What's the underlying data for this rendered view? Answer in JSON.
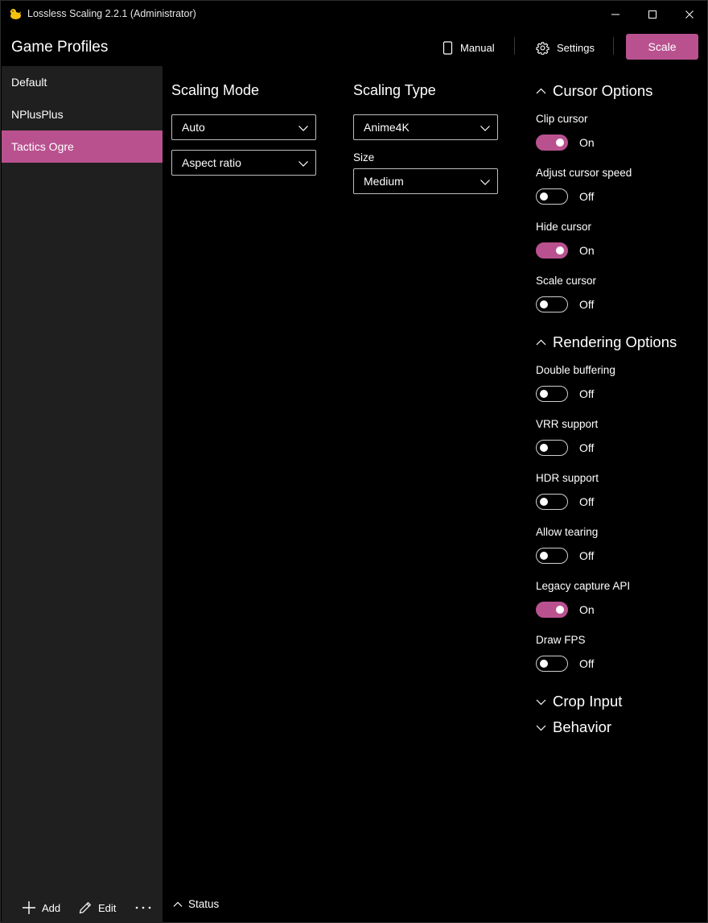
{
  "window": {
    "title": "Lossless Scaling 2.2.1 (Administrator)"
  },
  "header": {
    "title": "Game Profiles",
    "manual_label": "Manual",
    "settings_label": "Settings",
    "scale_label": "Scale"
  },
  "sidebar": {
    "items": [
      {
        "label": "Default",
        "selected": false
      },
      {
        "label": "NPlusPlus",
        "selected": false
      },
      {
        "label": "Tactics Ogre",
        "selected": true
      }
    ],
    "add_label": "Add",
    "edit_label": "Edit"
  },
  "scaling_mode": {
    "heading": "Scaling Mode",
    "mode_value": "Auto",
    "fit_value": "Aspect ratio"
  },
  "scaling_type": {
    "heading": "Scaling Type",
    "type_value": "Anime4K",
    "size_label": "Size",
    "size_value": "Medium"
  },
  "cursor_options": {
    "heading": "Cursor Options",
    "expanded": true,
    "items": [
      {
        "label": "Clip cursor",
        "state": "On"
      },
      {
        "label": "Adjust cursor speed",
        "state": "Off"
      },
      {
        "label": "Hide cursor",
        "state": "On"
      },
      {
        "label": "Scale cursor",
        "state": "Off"
      }
    ]
  },
  "rendering_options": {
    "heading": "Rendering Options",
    "expanded": true,
    "items": [
      {
        "label": "Double buffering",
        "state": "Off"
      },
      {
        "label": "VRR support",
        "state": "Off"
      },
      {
        "label": "HDR support",
        "state": "Off"
      },
      {
        "label": "Allow tearing",
        "state": "Off"
      },
      {
        "label": "Legacy capture API",
        "state": "On"
      },
      {
        "label": "Draw FPS",
        "state": "Off"
      }
    ]
  },
  "crop_input": {
    "heading": "Crop Input",
    "expanded": false
  },
  "behavior": {
    "heading": "Behavior",
    "expanded": false
  },
  "status": {
    "label": "Status"
  },
  "colors": {
    "accent": "#b9518f",
    "sidebar_bg": "#1f1f1f",
    "main_bg": "#000000"
  }
}
